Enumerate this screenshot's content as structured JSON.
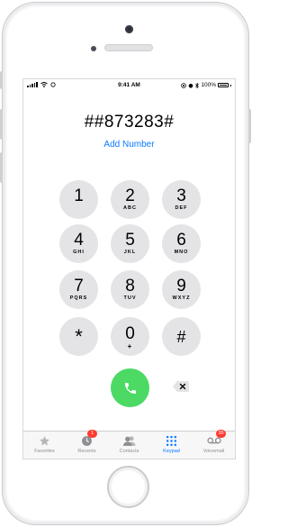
{
  "status_bar": {
    "time": "9:41 AM",
    "battery": "100%"
  },
  "dialer": {
    "number": "##873283#",
    "add_number": "Add Number"
  },
  "keypad": [
    {
      "digit": "1",
      "letters": ""
    },
    {
      "digit": "2",
      "letters": "ABC"
    },
    {
      "digit": "3",
      "letters": "DEF"
    },
    {
      "digit": "4",
      "letters": "GHI"
    },
    {
      "digit": "5",
      "letters": "JKL"
    },
    {
      "digit": "6",
      "letters": "MNO"
    },
    {
      "digit": "7",
      "letters": "PQRS"
    },
    {
      "digit": "8",
      "letters": "TUV"
    },
    {
      "digit": "9",
      "letters": "WXYZ"
    },
    {
      "digit": "*",
      "letters": ""
    },
    {
      "digit": "0",
      "letters": "+"
    },
    {
      "digit": "#",
      "letters": ""
    }
  ],
  "tabs": [
    {
      "label": "Favorites",
      "icon": "star-icon",
      "badge": ""
    },
    {
      "label": "Recents",
      "icon": "clock-icon",
      "badge": "1"
    },
    {
      "label": "Contacts",
      "icon": "contacts-icon",
      "badge": ""
    },
    {
      "label": "Keypad",
      "icon": "keypad-icon",
      "badge": "",
      "active": true
    },
    {
      "label": "Voicemail",
      "icon": "voicemail-icon",
      "badge": "35"
    }
  ],
  "colors": {
    "accent": "#0a7aff",
    "call": "#4cd964",
    "badge": "#ff3b30",
    "key": "#e4e4e6"
  }
}
